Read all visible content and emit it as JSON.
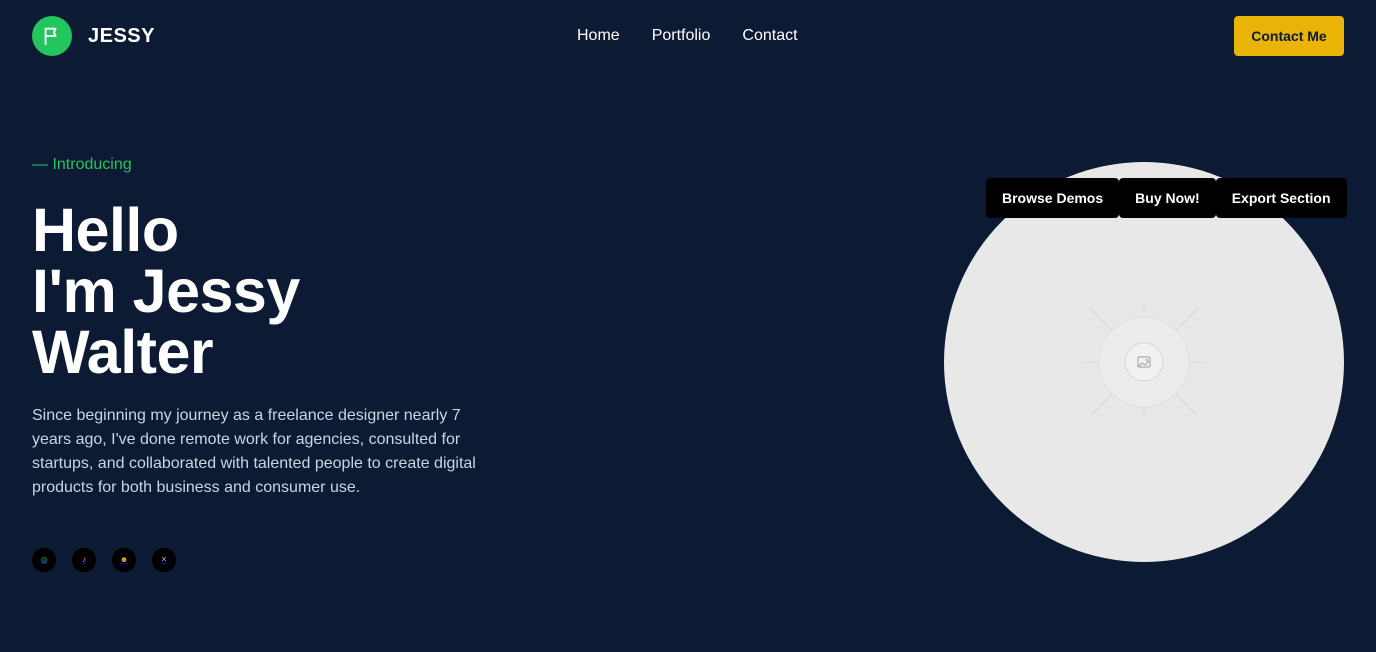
{
  "header": {
    "brand": "JESSY",
    "logo_icon": "flag-icon",
    "logo_color": "#22c55e",
    "nav": [
      "Home",
      "Portfolio",
      "Contact"
    ],
    "cta_label": "Contact Me",
    "cta_color": "#eab308"
  },
  "hero": {
    "eyebrow": "— Introducing",
    "headline": [
      "Hello",
      "I'm Jessy",
      "Walter"
    ],
    "bio": "Since beginning my journey as a freelance designer nearly 7 years ago, I've done remote work for agencies, consulted for startups, and collaborated with talented people to create digital products for both business and consumer use.",
    "socials": [
      {
        "icon": "dribbble-icon",
        "glyph": "◎",
        "color": "#22c55e"
      },
      {
        "icon": "music-note-icon",
        "glyph": "♪",
        "color": "#eab308"
      },
      {
        "icon": "github-icon",
        "glyph": "☻",
        "color": "#eab308"
      },
      {
        "icon": "x-icon",
        "glyph": "✕",
        "color": "#9ca3af"
      }
    ],
    "image_icon": "image-placeholder-icon",
    "image_bg": "#e8e8e8"
  },
  "floating_actions": [
    "Browse Demos",
    "Buy Now!",
    "Export Section"
  ],
  "colors": {
    "background": "#0c1a33",
    "accent_green": "#22c55e",
    "text_muted": "#cbd5e1"
  }
}
